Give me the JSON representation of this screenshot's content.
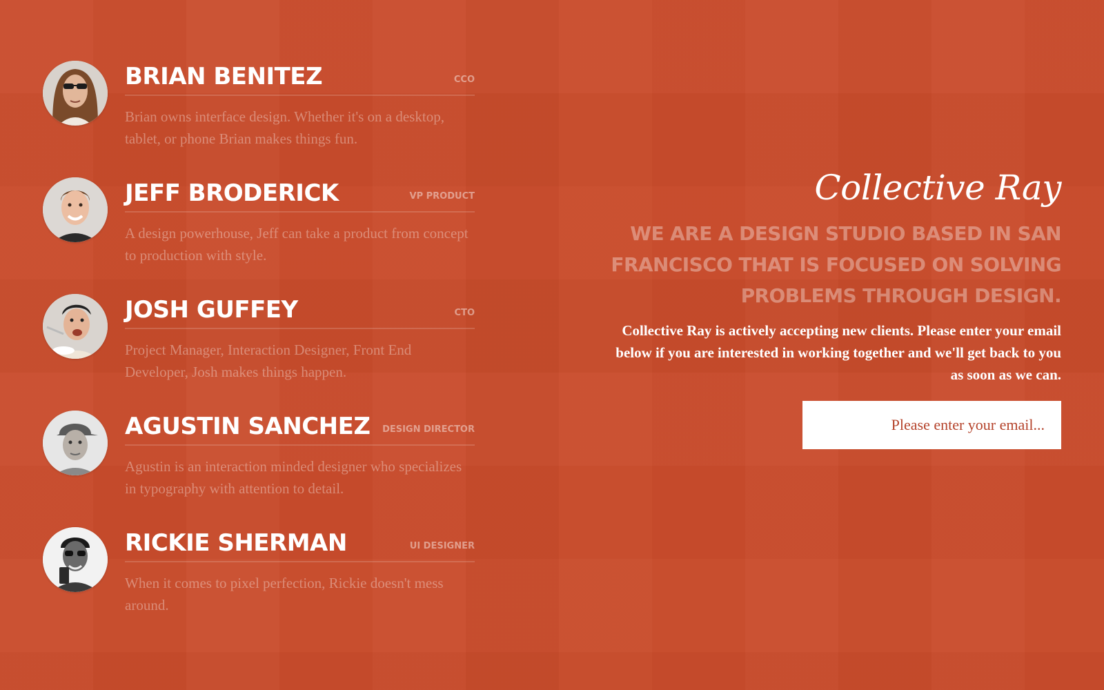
{
  "colors": {
    "background": "#c94c2c",
    "accent": "#ffffff"
  },
  "team": [
    {
      "name": "BRIAN BENITEZ",
      "role": "CCO",
      "bio": "Brian owns interface design. Whether it's on a desktop, tablet, or phone Brian makes things fun."
    },
    {
      "name": "JEFF BRODERICK",
      "role": "VP PRODUCT",
      "bio": "A design powerhouse, Jeff can take a product from concept to production with style."
    },
    {
      "name": "JOSH GUFFEY",
      "role": "CTO",
      "bio": "Project Manager, Interaction Designer, Front End Developer, Josh makes things happen."
    },
    {
      "name": "AGUSTIN SANCHEZ",
      "role": "DESIGN DIRECTOR",
      "bio": "Agustin is an interaction minded designer who specializes in typography with attention to detail."
    },
    {
      "name": "RICKIE SHERMAN",
      "role": "UI DESIGNER",
      "bio": "When it comes to pixel perfection, Rickie doesn't mess around."
    }
  ],
  "pitch": {
    "logo": "Collective Ray",
    "headline": "WE ARE A DESIGN STUDIO BASED IN SAN FRANCISCO THAT IS FOCUSED ON SOLVING PROBLEMS THROUGH DESIGN.",
    "blurb": "Collective Ray is actively accepting new clients. Please enter your email below if you are interested in working together and we'll get back to you as soon as we can.",
    "email_placeholder": "Please enter your email..."
  }
}
